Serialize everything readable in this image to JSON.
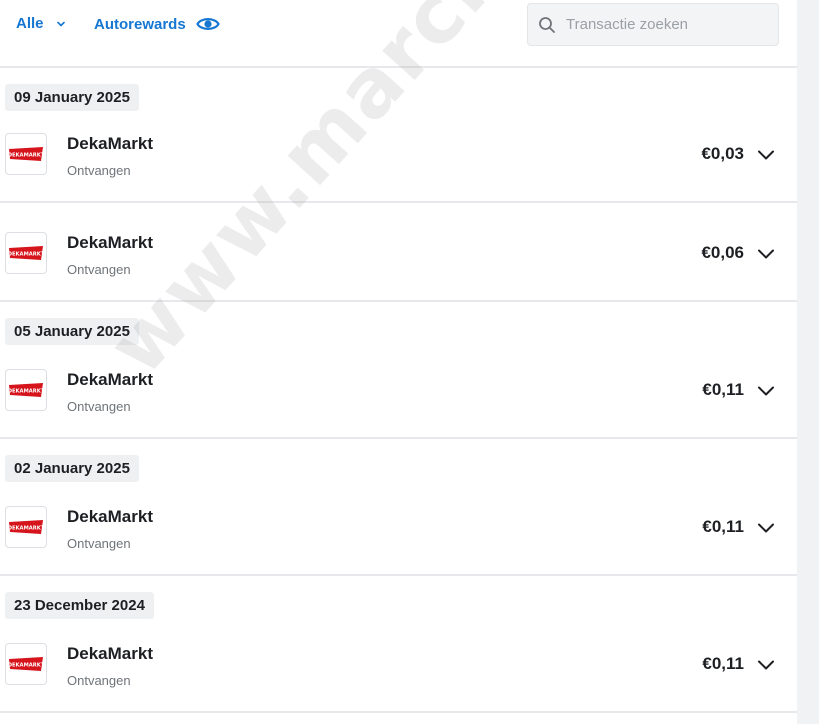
{
  "header": {
    "filter_label": "Alle",
    "autorewards_label": "Autorewards",
    "search_placeholder": "Transactie zoeken"
  },
  "colors": {
    "accent": "#1677d2",
    "text": "#1d1f23",
    "muted": "#6f7479",
    "chip_bg": "#eef0f2",
    "divider": "#e6e8eb",
    "logo_red": "#d6141c"
  },
  "groups": [
    {
      "date": "09 January 2025",
      "transactions": [
        {
          "merchant": "DekaMarkt",
          "status": "Ontvangen",
          "amount": "€0,03"
        },
        {
          "merchant": "DekaMarkt",
          "status": "Ontvangen",
          "amount": "€0,06"
        }
      ]
    },
    {
      "date": "05 January 2025",
      "transactions": [
        {
          "merchant": "DekaMarkt",
          "status": "Ontvangen",
          "amount": "€0,11"
        }
      ]
    },
    {
      "date": "02 January 2025",
      "transactions": [
        {
          "merchant": "DekaMarkt",
          "status": "Ontvangen",
          "amount": "€0,11"
        }
      ]
    },
    {
      "date": "23 December 2024",
      "transactions": [
        {
          "merchant": "DekaMarkt",
          "status": "Ontvangen",
          "amount": "€0,11"
        }
      ]
    }
  ],
  "logo": {
    "text": "DEKAMARKT"
  },
  "watermark": {
    "text": "www.marchealthy.nl"
  },
  "icons": {
    "filter": "chevron-down-icon",
    "autorewards": "eye-icon",
    "search": "search-icon",
    "expand": "chevron-down-icon"
  }
}
